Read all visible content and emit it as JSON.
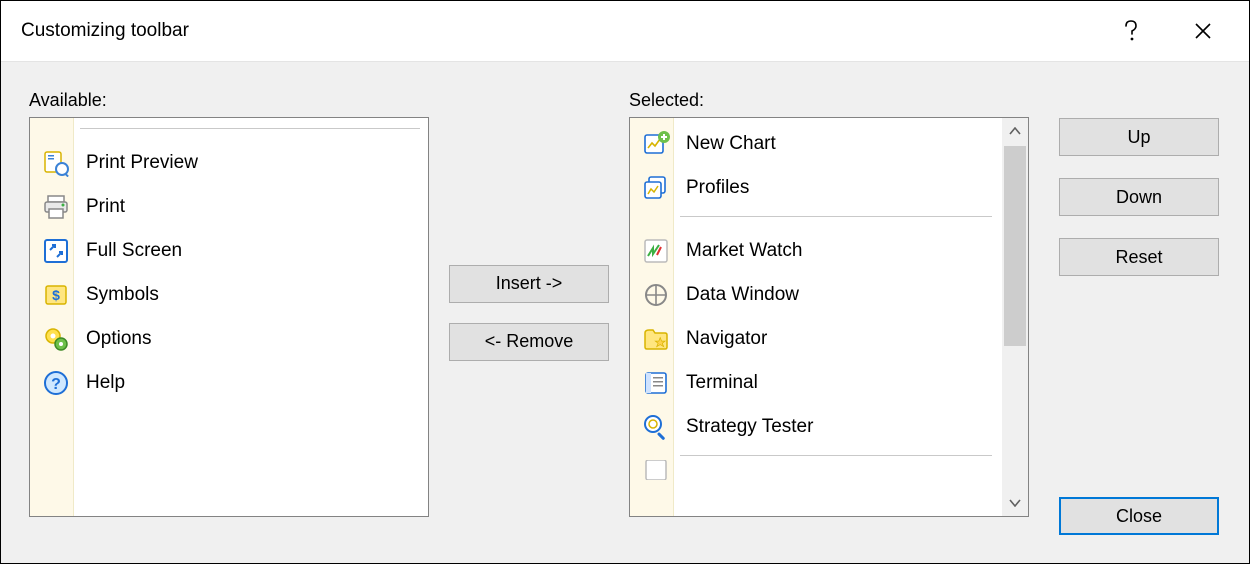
{
  "title": "Customizing toolbar",
  "labels": {
    "available": "Available:",
    "selected": "Selected:"
  },
  "buttons": {
    "insert": "Insert ->",
    "remove": "<- Remove",
    "up": "Up",
    "down": "Down",
    "reset": "Reset",
    "close": "Close"
  },
  "available": {
    "0": "Print Preview",
    "1": "Print",
    "2": "Full Screen",
    "3": "Symbols",
    "4": "Options",
    "5": "Help"
  },
  "selected": {
    "0": "New Chart",
    "1": "Profiles",
    "2": "Market Watch",
    "3": "Data Window",
    "4": "Navigator",
    "5": "Terminal",
    "6": "Strategy Tester"
  }
}
